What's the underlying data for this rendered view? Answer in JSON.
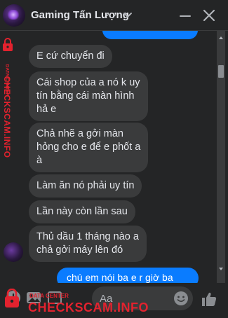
{
  "header": {
    "contact_name": "Gaming Tấn Lượng"
  },
  "messages": [
    {
      "from": "contact",
      "text": "E cứ chuyển đi"
    },
    {
      "from": "contact",
      "text": "Cái shop của a nó k uy\ntín bằng cái màn hình\nhả e"
    },
    {
      "from": "contact",
      "text": "Chả nhẽ a gởi màn\nhỏng cho e để e phốt a\nà"
    },
    {
      "from": "contact",
      "text": "Làm ăn nó phải uy tín"
    },
    {
      "from": "contact",
      "text": "Lần này còn lần sau"
    },
    {
      "from": "contact",
      "text": "Thủ dầu 1 tháng nào a\nchả gởi máy lên đó"
    },
    {
      "from": "me",
      "text": "chú em nói ba e r giờ ba"
    }
  ],
  "composer": {
    "placeholder": "Aa"
  },
  "watermark": {
    "small": "DATA CENTER",
    "big": "CHECKSCAM.INFO"
  },
  "colors": {
    "outgoing": "#0a7cff",
    "incoming": "#3a3b3c",
    "accent": "#e3222e"
  }
}
